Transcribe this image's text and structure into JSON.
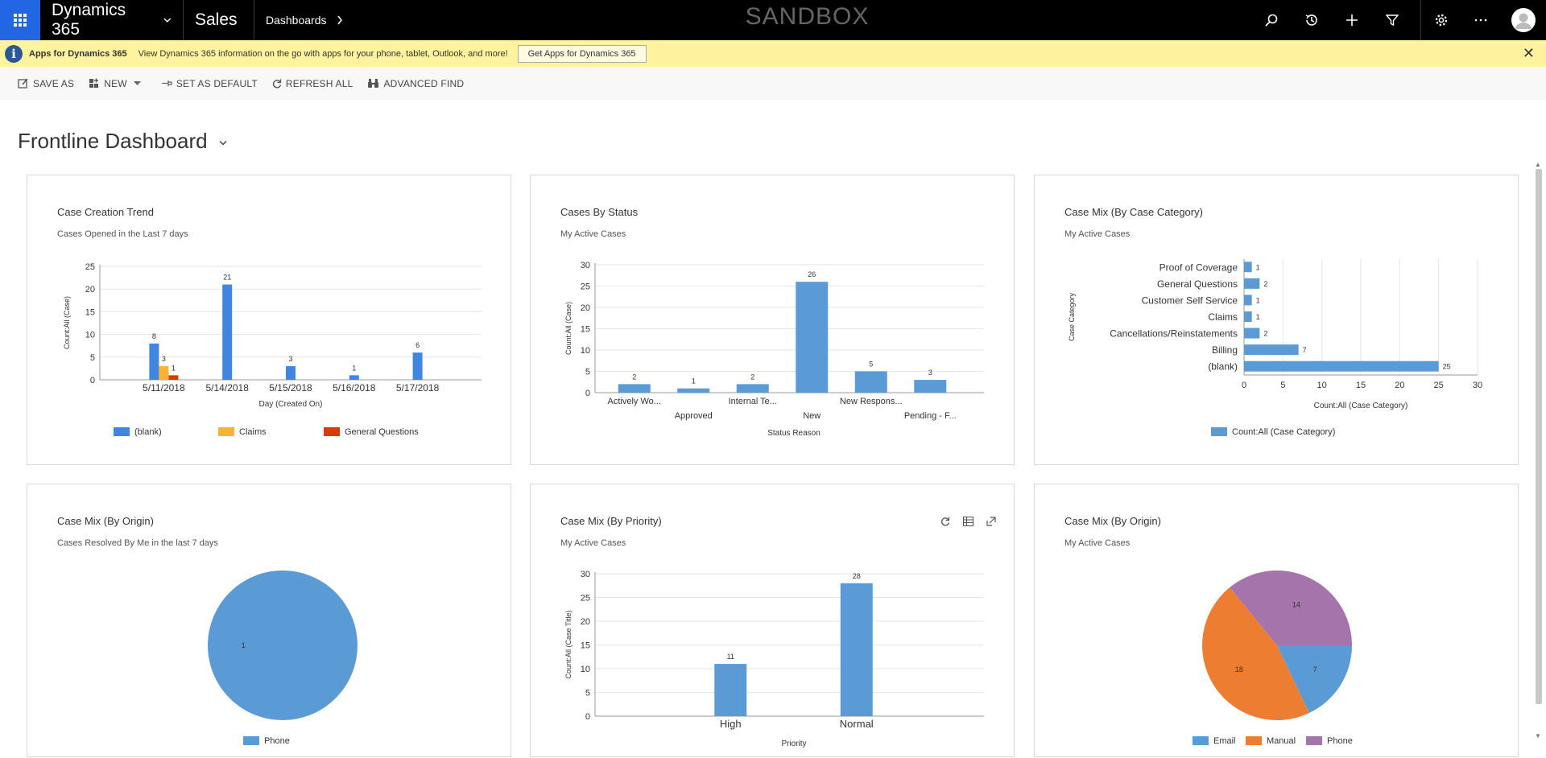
{
  "topbar": {
    "app_name": "Dynamics 365",
    "module": "Sales",
    "breadcrumb": "Dashboards",
    "environment": "SANDBOX",
    "icons": [
      "search-icon",
      "recent-icon",
      "add-icon",
      "filter-icon",
      "settings-icon",
      "more-icon",
      "avatar"
    ]
  },
  "banner": {
    "title": "Apps for Dynamics 365",
    "message": "View Dynamics 365 information on the go with apps for your phone, tablet, Outlook, and more!",
    "button": "Get Apps for Dynamics 365",
    "close": "✕"
  },
  "commands": {
    "save_as": "SAVE AS",
    "new": "NEW",
    "set_default": "SET AS DEFAULT",
    "refresh_all": "REFRESH ALL",
    "advanced_find": "ADVANCED FIND"
  },
  "dashboard": {
    "title": "Frontline Dashboard"
  },
  "colors": {
    "blue": "#5b9bd5",
    "blue_dark": "#3e86e0",
    "orange": "#ed7d31",
    "amber": "#f9b233",
    "red": "#d83b01",
    "purple": "#a574ab"
  },
  "cards": {
    "c1": {
      "title": "Case Creation Trend",
      "subtitle": "Cases Opened in the Last 7 days"
    },
    "c2": {
      "title": "Cases By Status",
      "subtitle": "My Active Cases"
    },
    "c3": {
      "title": "Case Mix (By Case Category)",
      "subtitle": "My Active Cases"
    },
    "c4": {
      "title": "Case Mix (By Origin)",
      "subtitle": "Cases Resolved By Me in the last 7 days"
    },
    "c5": {
      "title": "Case Mix (By Priority)",
      "subtitle": "My Active Cases",
      "icons": [
        "refresh-icon",
        "table-icon",
        "expand-icon"
      ]
    },
    "c6": {
      "title": "Case Mix (By Origin)",
      "subtitle": "My Active Cases"
    }
  },
  "chart_data": [
    {
      "type": "bar",
      "title": "Case Creation Trend",
      "xlabel": "Day (Created On)",
      "ylabel": "Count:All (Case)",
      "ylim": [
        0,
        25
      ],
      "yticks": [
        0,
        5,
        10,
        15,
        20,
        25
      ],
      "categories": [
        "5/11/2018",
        "5/14/2018",
        "5/15/2018",
        "5/16/2018",
        "5/17/2018"
      ],
      "series": [
        {
          "name": "(blank)",
          "color": "#3e86e0",
          "values": [
            8,
            21,
            3,
            1,
            6
          ]
        },
        {
          "name": "Claims",
          "color": "#f9b233",
          "values": [
            3,
            null,
            null,
            null,
            null
          ]
        },
        {
          "name": "General Questions",
          "color": "#d83b01",
          "values": [
            1,
            null,
            null,
            null,
            null
          ]
        }
      ],
      "grid": true,
      "legend": "bottom"
    },
    {
      "type": "bar",
      "title": "Cases By Status",
      "xlabel": "Status Reason",
      "ylabel": "Count:All (Case)",
      "ylim": [
        0,
        30
      ],
      "yticks": [
        0,
        5,
        10,
        15,
        20,
        25,
        30
      ],
      "categories": [
        "Actively Wo...",
        "Approved",
        "Internal Te...",
        "New",
        "New Respons...",
        "Pending - F..."
      ],
      "values": [
        2,
        1,
        2,
        26,
        5,
        3
      ],
      "grid": true
    },
    {
      "type": "bar",
      "orientation": "horizontal",
      "title": "Case Mix (By Case Category)",
      "xlabel": "Count:All (Case Category)",
      "ylabel": "Case Category",
      "xlim": [
        0,
        30
      ],
      "xticks": [
        0,
        5,
        10,
        15,
        20,
        25,
        30
      ],
      "categories": [
        "Proof of Coverage",
        "General Questions",
        "Customer Self Service",
        "Claims",
        "Cancellations/Reinstatements",
        "Billing",
        "(blank)"
      ],
      "values": [
        1,
        2,
        1,
        1,
        2,
        7,
        25
      ],
      "series_name": "Count:All (Case Category)",
      "grid": true,
      "legend": "bottom"
    },
    {
      "type": "pie",
      "title": "Case Mix (By Origin)",
      "slices": [
        {
          "label": "Phone",
          "value": 1,
          "color": "#5b9bd5"
        }
      ],
      "legend": "bottom"
    },
    {
      "type": "bar",
      "title": "Case Mix (By Priority)",
      "xlabel": "Priority",
      "ylabel": "Count:All (Case Title)",
      "ylim": [
        0,
        30
      ],
      "yticks": [
        0,
        5,
        10,
        15,
        20,
        25,
        30
      ],
      "categories": [
        "High",
        "Normal"
      ],
      "values": [
        11,
        28
      ],
      "grid": true
    },
    {
      "type": "pie",
      "title": "Case Mix (By Origin)",
      "slices": [
        {
          "label": "Email",
          "value": 7,
          "color": "#5b9bd5"
        },
        {
          "label": "Manual",
          "value": 18,
          "color": "#ed7d31"
        },
        {
          "label": "Phone",
          "value": 14,
          "color": "#a574ab"
        }
      ],
      "legend": "bottom"
    }
  ]
}
